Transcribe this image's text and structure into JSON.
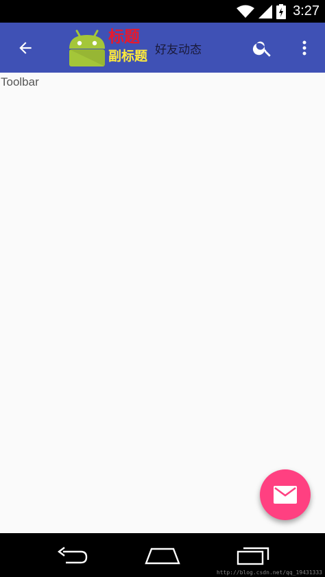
{
  "status_bar": {
    "time": "3:27"
  },
  "toolbar": {
    "title": "标题",
    "subtitle": "副标题",
    "custom_label": "好友动态",
    "colors": {
      "background": "#3F51B5",
      "title": "#E8192C",
      "subtitle": "#FFEB3B"
    },
    "icons": {
      "navigation": "arrow-back-icon",
      "logo": "android-logo-icon",
      "search": "search-icon",
      "overflow": "more-vert-icon"
    }
  },
  "content": {
    "label": "Toolbar",
    "background": "#FAFAFA"
  },
  "fab": {
    "icon": "email-icon",
    "color": "#FF4081"
  },
  "nav_bar": {
    "icons": [
      "back-icon",
      "home-icon",
      "recents-icon"
    ]
  },
  "watermark": "http://blog.csdn.net/qq_19431333"
}
